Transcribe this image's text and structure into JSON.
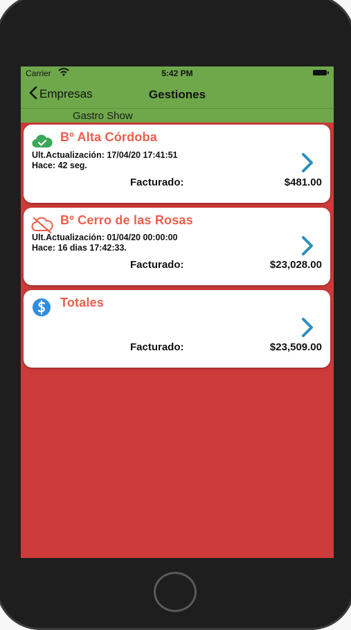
{
  "status_bar": {
    "carrier": "Carrier",
    "time": "5:42 PM"
  },
  "nav": {
    "back_label": "Empresas",
    "title": "Gestiones"
  },
  "subheader": {
    "company": "Gastro Show"
  },
  "cards": [
    {
      "title": "Bº Alta Córdoba",
      "status_icon": "cloud-check-icon",
      "last_update": "Ult.Actualización: 17/04/20 17:41:51",
      "ago": "Hace: 42 seg.",
      "billed_label": "Facturado:",
      "billed_amount": "$481.00"
    },
    {
      "title": "Bº Cerro de las Rosas",
      "status_icon": "cloud-offline-icon",
      "last_update": "Ult.Actualización: 01/04/20 00:00:00",
      "ago": "Hace: 16 dias 17:42:33.",
      "billed_label": "Facturado:",
      "billed_amount": "$23,028.00"
    },
    {
      "title": "Totales",
      "status_icon": "dollar-circle-icon",
      "billed_label": "Facturado:",
      "billed_amount": "$23,509.00"
    }
  ],
  "colors": {
    "nav_green": "#6fa84b",
    "background_red": "#cc3b3a",
    "title_orange": "#ea5f4d",
    "chevron_blue": "#2a8fbd",
    "ok_green": "#3aa858",
    "dollar_blue": "#2f8ee0"
  }
}
